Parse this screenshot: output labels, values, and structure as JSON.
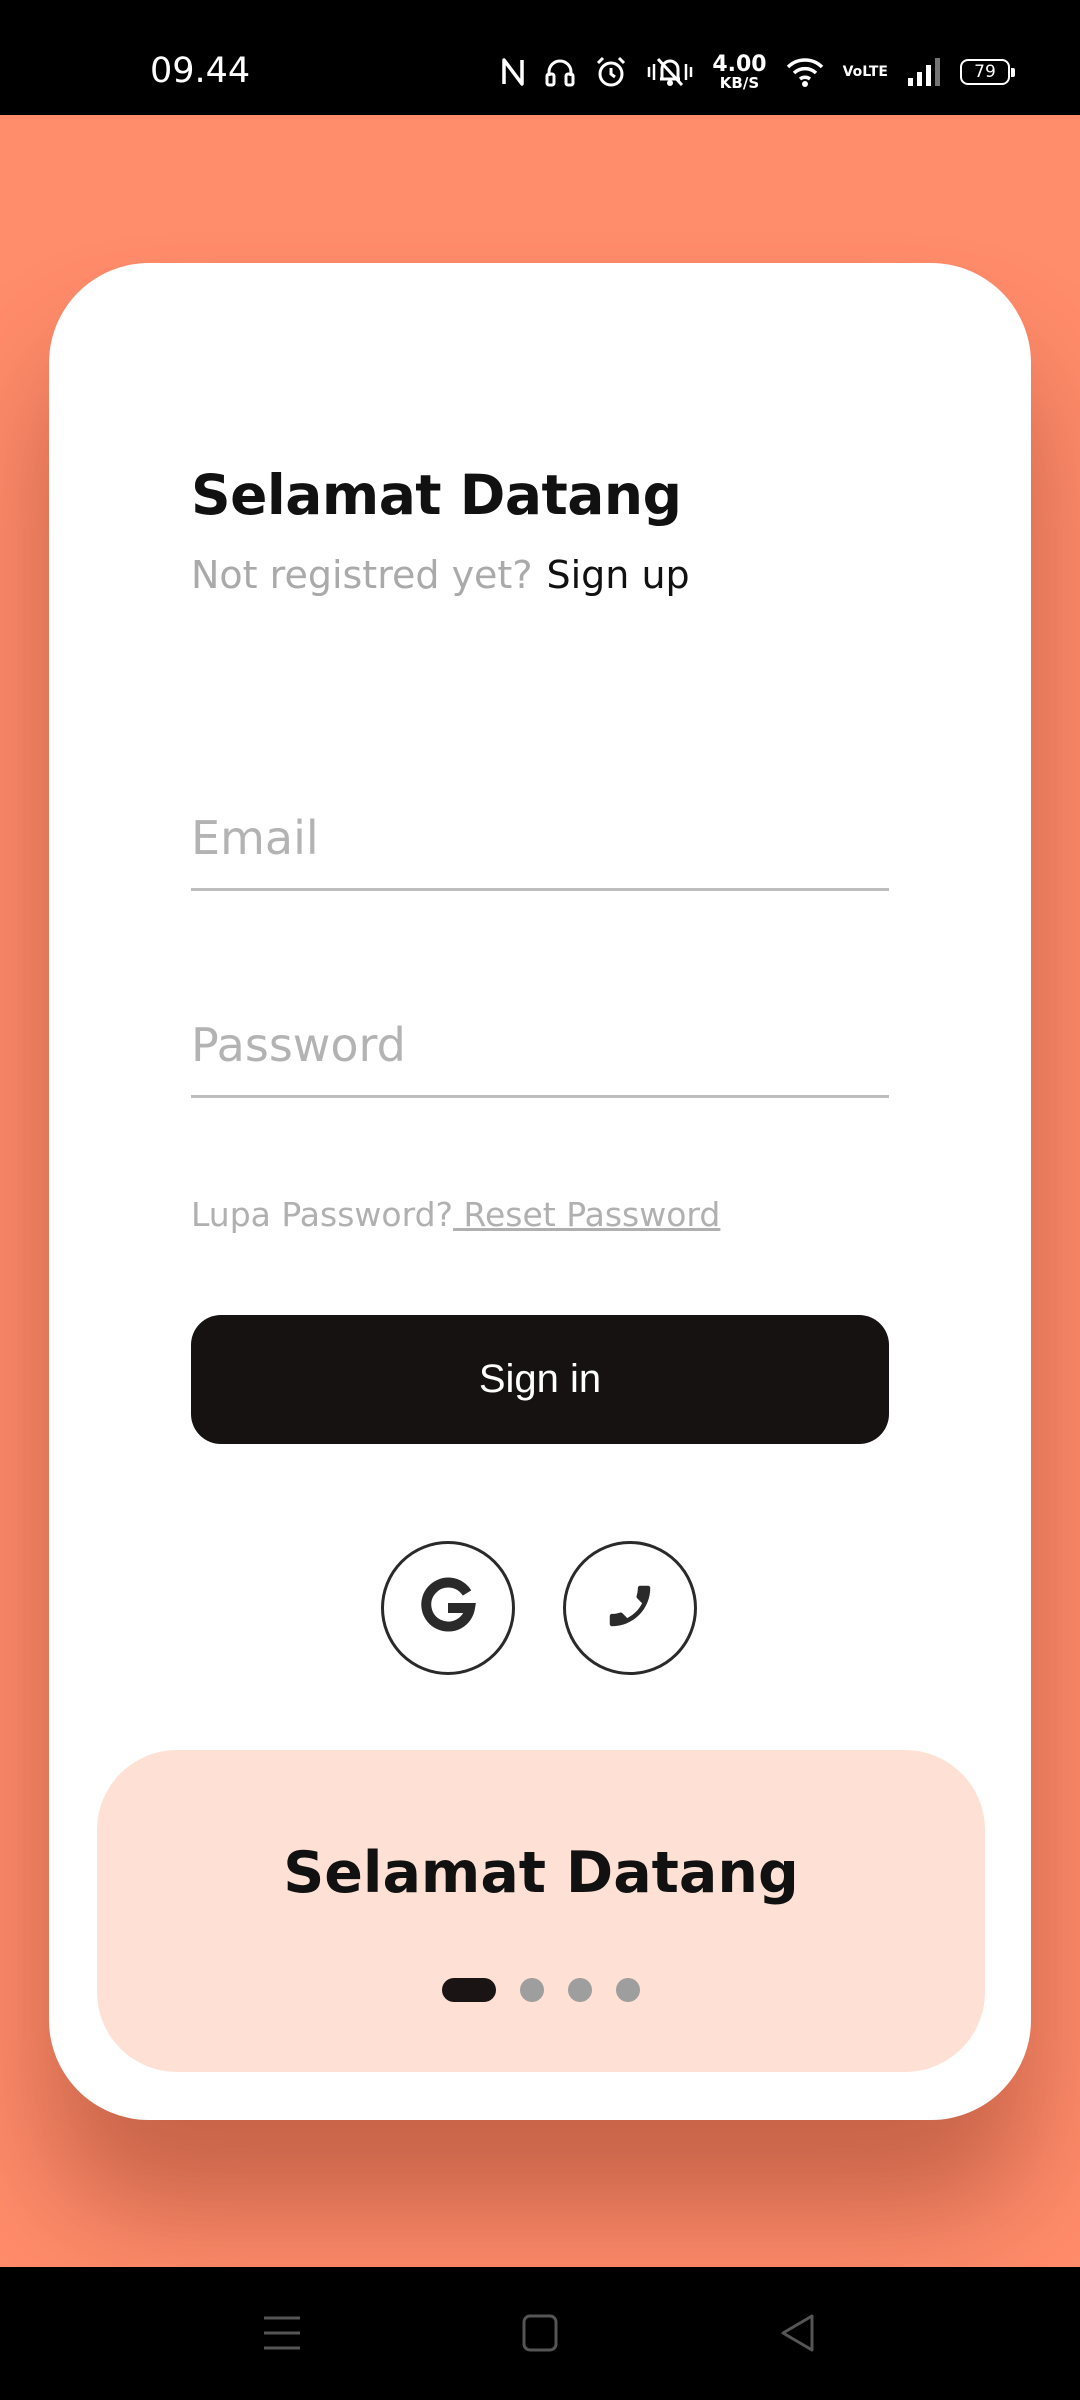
{
  "status_bar": {
    "time": "09.44",
    "net_speed_value": "4.00",
    "net_speed_unit": "KB/S",
    "volte_top": "Vo",
    "volte_bottom": "LTE",
    "battery": "79",
    "icons": [
      "nfc-icon",
      "headphones-icon",
      "alarm-icon",
      "vibrate-off-icon",
      "wifi-icon",
      "volte-icon",
      "signal-icon",
      "battery-icon"
    ]
  },
  "login": {
    "title": "Selamat Datang",
    "not_registered": "Not registred yet?",
    "sign_up": "Sign up",
    "email_placeholder": "Email",
    "password_placeholder": "Password",
    "forgot_text": "Lupa Password?",
    "reset_text": " Reset Password",
    "signin_label": "Sign in",
    "social": [
      "google-icon",
      "phone-icon"
    ]
  },
  "banner": {
    "title": "Selamat Datang",
    "page_count": 4,
    "active_page": 1
  },
  "nav_bar": {
    "icons": [
      "menu-icon",
      "home-icon",
      "back-icon"
    ]
  },
  "colors": {
    "background": "#FF8C6B",
    "card": "#FFFFFF",
    "banner": "#FFE0D4",
    "button": "#161212"
  }
}
